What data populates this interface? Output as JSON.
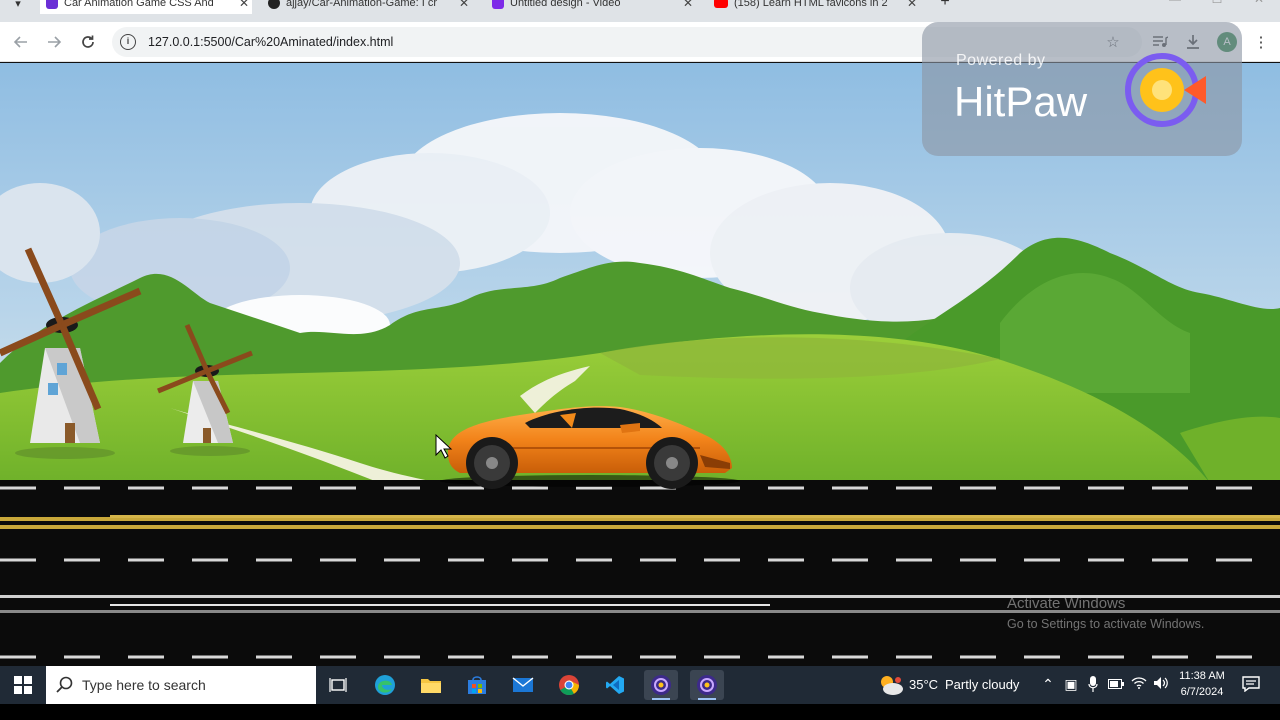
{
  "browser": {
    "tabs": [
      {
        "title": "Car Animation Game CSS And",
        "favicon_color": "#6b2fd6",
        "active": true
      },
      {
        "title": "ajjay/Car-Animation-Game: I cr",
        "favicon_color": "#222222",
        "active": false
      },
      {
        "title": "Untitled design - Video",
        "favicon_color": "#7d2ae8",
        "active": false
      },
      {
        "title": "(158) Learn HTML favicons in 2",
        "favicon_color": "#ff0000",
        "active": false
      }
    ],
    "address": "127.0.0.1:5500/Car%20Aminated/index.html",
    "profile_initial": "A"
  },
  "watermark": {
    "powered_by": "Powered by",
    "brand": "HitPaw"
  },
  "activation": {
    "line1": "Activate Windows",
    "line2": "Go to Settings to activate Windows."
  },
  "taskbar": {
    "search_placeholder": "Type here to search",
    "apps": [
      "task-view",
      "edge",
      "file-explorer",
      "store",
      "mail",
      "chrome",
      "vscode",
      "hitpaw-1",
      "hitpaw-2"
    ],
    "weather": {
      "temp": "35°C",
      "desc": "Partly cloudy"
    },
    "clock": {
      "time": "11:38 AM",
      "date": "6/7/2024"
    }
  },
  "colors": {
    "sky_top": "#9fc6e6",
    "grass": "#8bc832",
    "road": "#0b0b0b",
    "car": "#f28a1a"
  }
}
